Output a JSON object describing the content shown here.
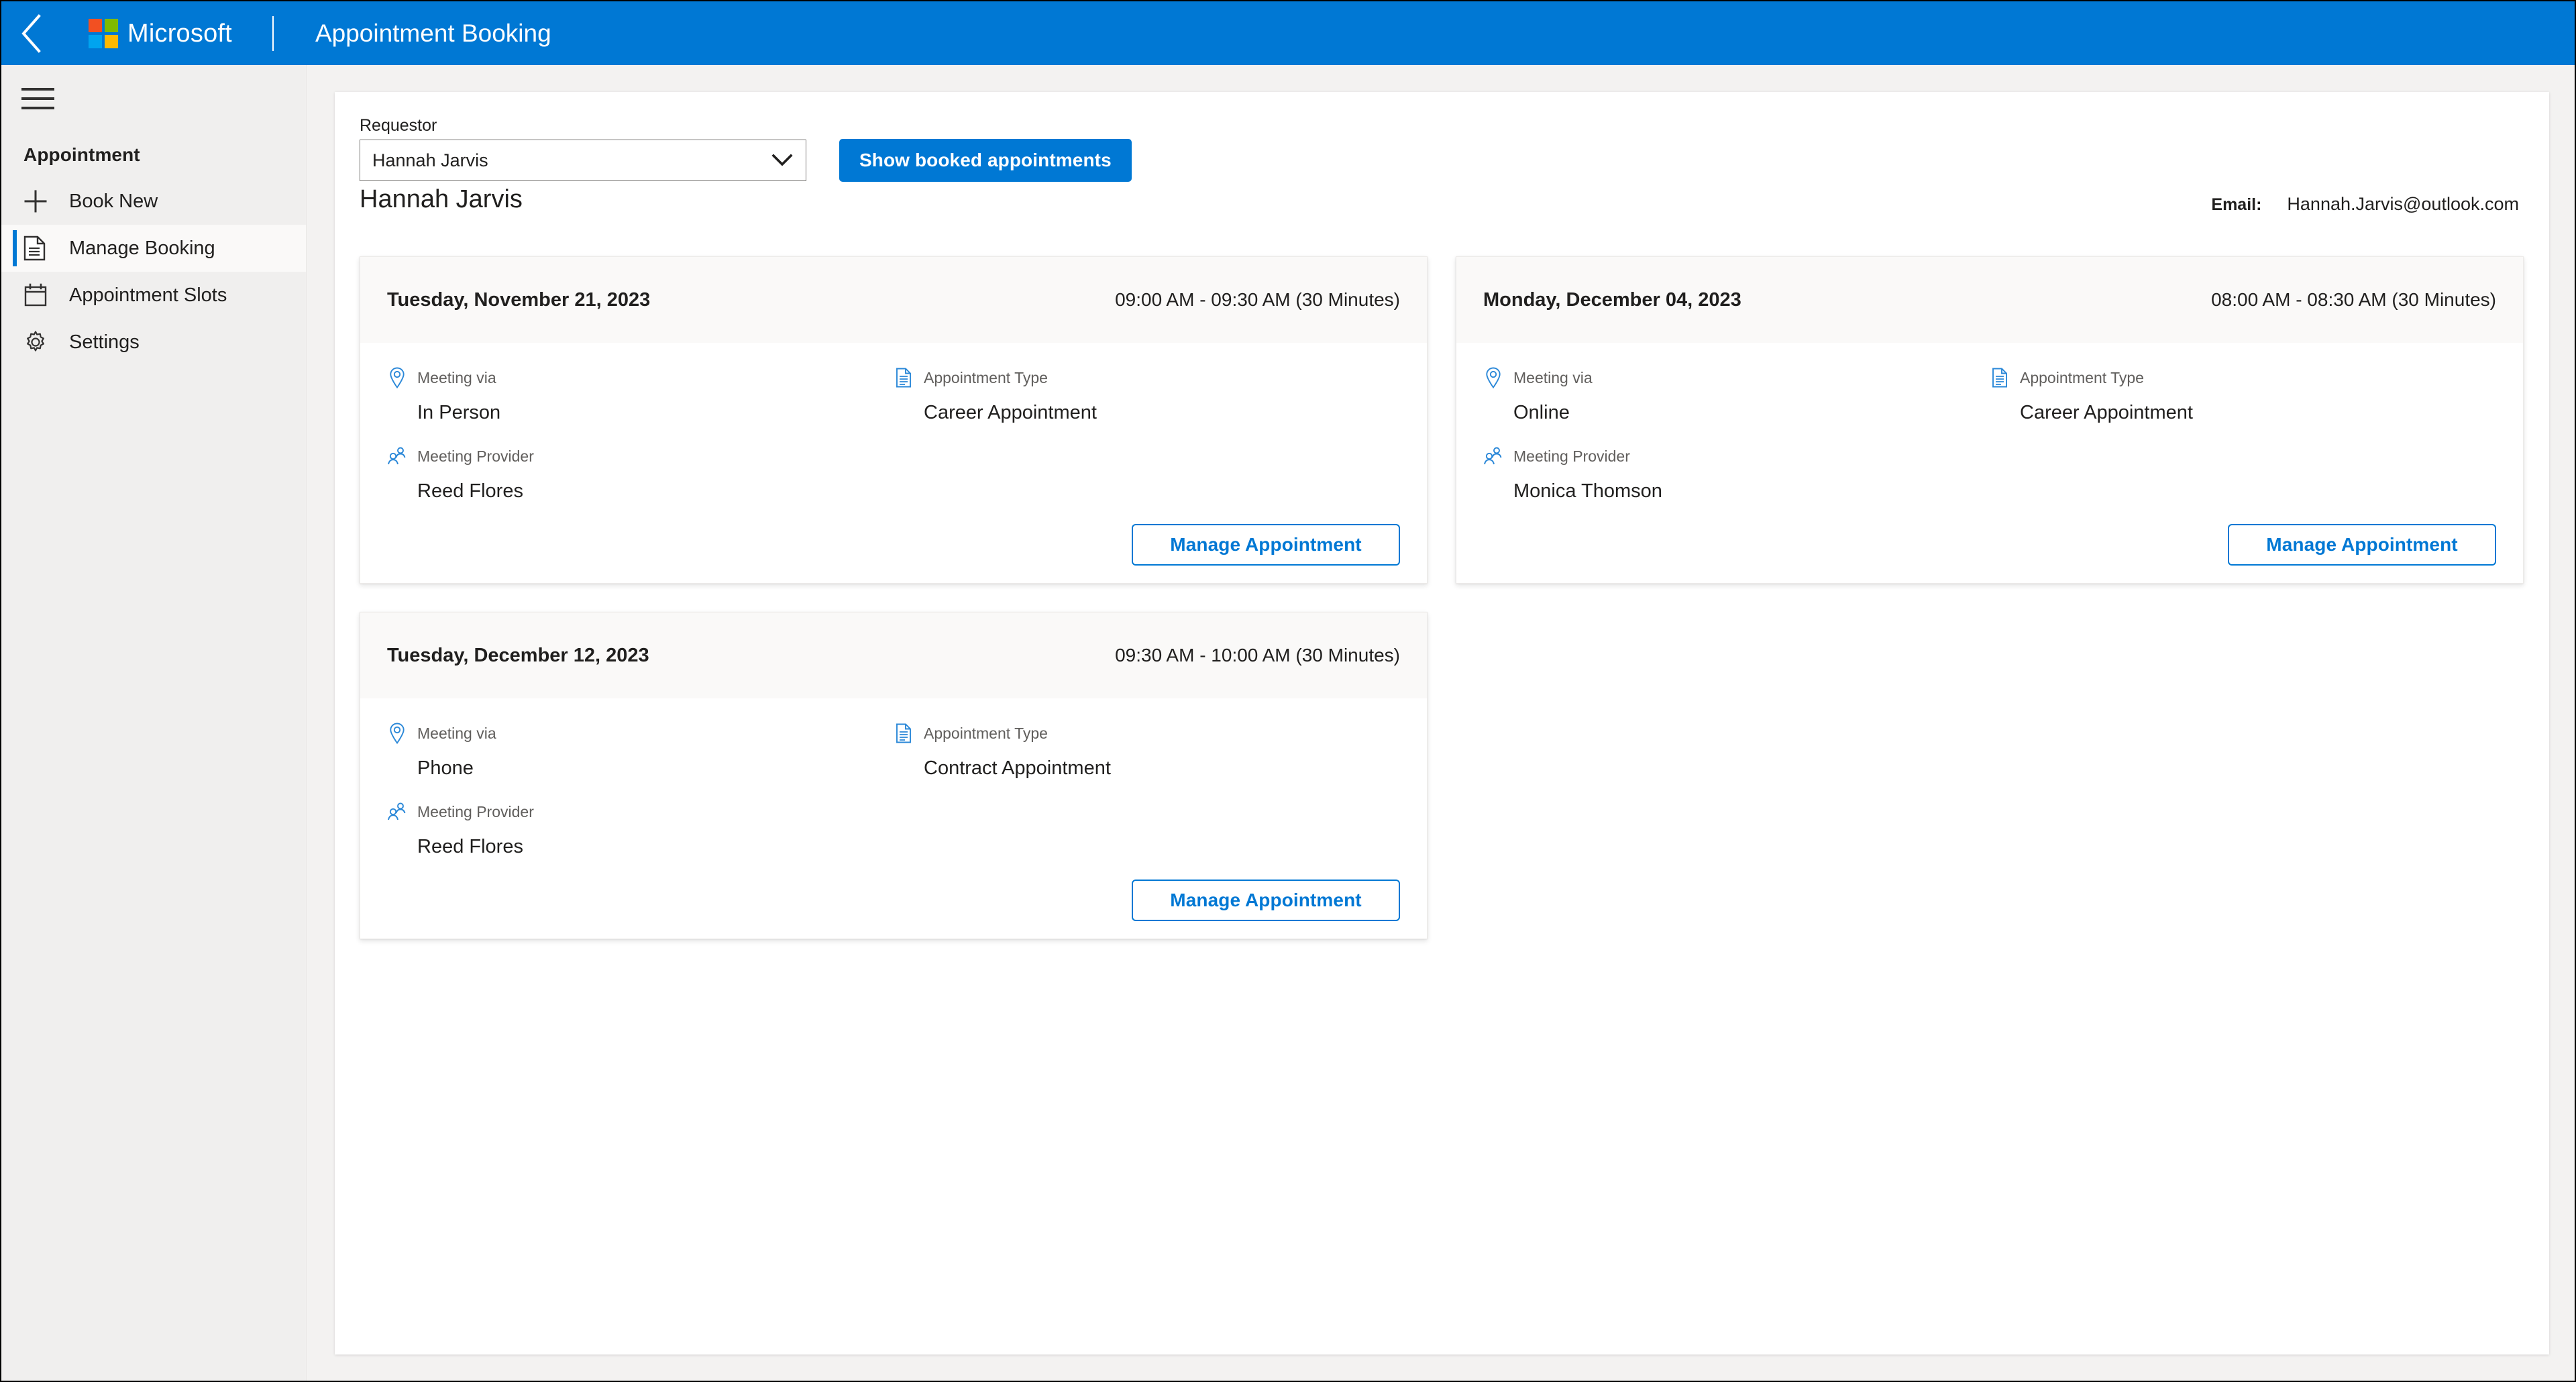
{
  "header": {
    "back_icon": "back-chevron-icon",
    "brand": "Microsoft",
    "app_title": "Appointment Booking",
    "brand_color": "#0078D4"
  },
  "sidebar": {
    "menu_icon": "hamburger-menu-icon",
    "section_title": "Appointment",
    "items": [
      {
        "label": "Book New",
        "icon": "plus-icon",
        "selected": false
      },
      {
        "label": "Manage Booking",
        "icon": "document-icon",
        "selected": true
      },
      {
        "label": "Appointment Slots",
        "icon": "calendar-icon",
        "selected": false
      },
      {
        "label": "Settings",
        "icon": "gear-icon",
        "selected": false
      }
    ]
  },
  "toolbar": {
    "requestor_label": "Requestor",
    "requestor_value": "Hannah Jarvis",
    "requestor_chevron_icon": "chevron-down-icon",
    "show_button_label": "Show booked appointments"
  },
  "requestor": {
    "name": "Hannah Jarvis",
    "email_label": "Email:",
    "email_value": "Hannah.Jarvis@outlook.com"
  },
  "field_labels": {
    "meeting_via": "Meeting via",
    "appointment_type": "Appointment Type",
    "meeting_provider": "Meeting Provider"
  },
  "card_action_label": "Manage Appointment",
  "appointments": [
    {
      "date": "Tuesday, November 21, 2023",
      "time": "09:00 AM - 09:30 AM (30 Minutes)",
      "meeting_via": "In Person",
      "appointment_type": "Career Appointment",
      "meeting_provider": "Reed Flores",
      "action": "Manage Appointment"
    },
    {
      "date": "Monday, December 04, 2023",
      "time": "08:00 AM - 08:30 AM (30 Minutes)",
      "meeting_via": "Online",
      "appointment_type": "Career Appointment",
      "meeting_provider": "Monica Thomson",
      "action": "Manage Appointment"
    },
    {
      "date": "Tuesday, December 12, 2023",
      "time": "09:30 AM - 10:00 AM (30 Minutes)",
      "meeting_via": "Phone",
      "appointment_type": "Contract Appointment",
      "meeting_provider": "Reed Flores",
      "action": "Manage Appointment"
    }
  ],
  "colors": {
    "accent": "#0078D4",
    "sidebar_bg": "#F0EFEE",
    "card_header_bg": "#FAF9F8",
    "page_bg": "#F3F2F1",
    "text": "#201F1E",
    "muted_text": "#605E5C"
  }
}
